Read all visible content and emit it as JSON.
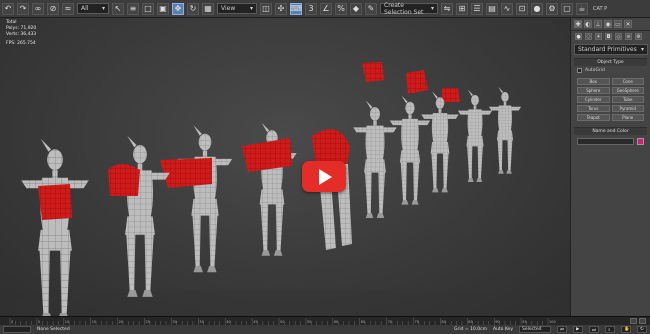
{
  "toolbar": {
    "selection_filter": "All",
    "reference_coord": "View",
    "named_selection": "Create Selection Set"
  },
  "viewport": {
    "stats_total_label": "Total",
    "stats_polys_label": "Polys:",
    "stats_polys_value": "71,920",
    "stats_verts_label": "Verts:",
    "stats_verts_value": "36,433",
    "stats_fps_label": "FPS:",
    "stats_fps_value": "265.754"
  },
  "command_panel": {
    "primitive_type": "Standard Primitives",
    "object_type_title": "Object Type",
    "autogrid_label": "AutoGrid",
    "buttons": [
      "Box",
      "Cone",
      "Sphere",
      "GeoSphere",
      "Cylinder",
      "Tube",
      "Torus",
      "Pyramid",
      "Teapot",
      "Plane"
    ],
    "name_color_title": "Name and Color",
    "object_color": "#d0207a"
  },
  "title_fragment": "CAT P",
  "timeline": {
    "frame_labels": [
      "0",
      "5",
      "10",
      "15",
      "20",
      "25",
      "30",
      "35",
      "40",
      "45",
      "50",
      "55",
      "60",
      "65",
      "70",
      "75",
      "80",
      "85",
      "90",
      "95",
      "100"
    ]
  },
  "statusbar": {
    "selection_status": "None Selected",
    "grid_readout": "Grid = 10.0cm",
    "autokey_label": "Auto Key",
    "autokey_value": "Selected"
  },
  "video_overlay": {
    "play_button": "play-icon",
    "accent": "#e52d27"
  }
}
